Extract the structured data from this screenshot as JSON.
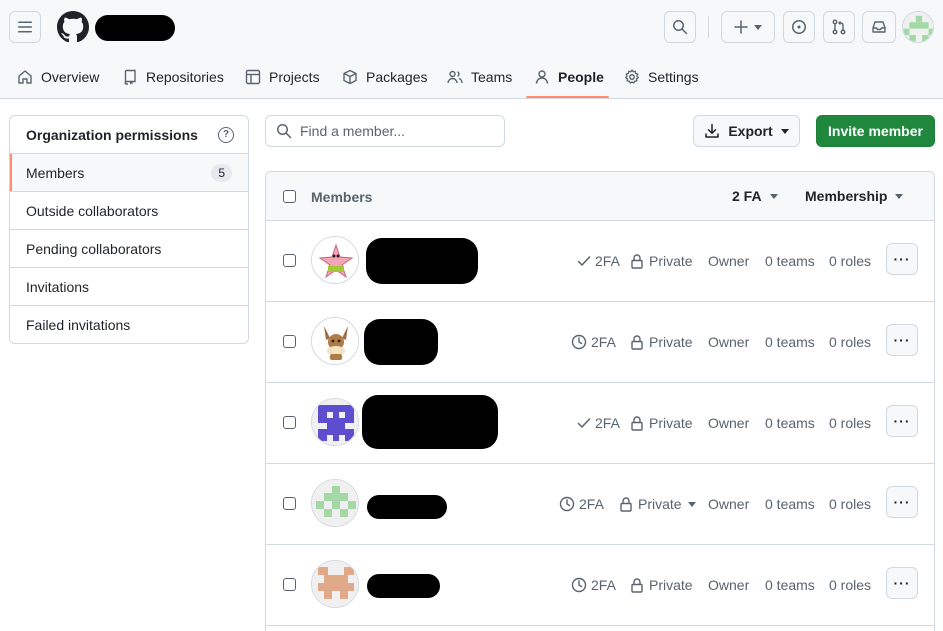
{
  "header": {
    "hamburger_icon": "three-bars-icon",
    "logo_icon": "github-mark-icon"
  },
  "nav": {
    "tabs": [
      {
        "label": "Overview",
        "icon": "home-icon"
      },
      {
        "label": "Repositories",
        "icon": "repo-icon"
      },
      {
        "label": "Projects",
        "icon": "table-icon"
      },
      {
        "label": "Packages",
        "icon": "package-icon"
      },
      {
        "label": "Teams",
        "icon": "people-icon"
      },
      {
        "label": "People",
        "icon": "person-icon",
        "active": true
      },
      {
        "label": "Settings",
        "icon": "gear-icon"
      }
    ]
  },
  "sidebar": {
    "title": "Organization permissions",
    "items": [
      {
        "label": "Members",
        "count": "5",
        "selected": true
      },
      {
        "label": "Outside collaborators"
      },
      {
        "label": "Pending collaborators"
      },
      {
        "label": "Invitations"
      },
      {
        "label": "Failed invitations"
      }
    ]
  },
  "toolbar": {
    "search_placeholder": "Find a member...",
    "export_label": "Export",
    "invite_label": "Invite member"
  },
  "table": {
    "header_members": "Members",
    "header_2fa": "2 FA",
    "header_membership": "Membership",
    "rows": [
      {
        "twofa": "2FA",
        "twofa_icon": "check-icon",
        "visibility": "Private",
        "role": "Owner",
        "teams": "0 teams",
        "roles": "0 roles",
        "avatar": "patrick-star-avatar"
      },
      {
        "twofa": "2FA",
        "twofa_icon": "clock-icon",
        "visibility": "Private",
        "role": "Owner",
        "teams": "0 teams",
        "roles": "0 roles",
        "avatar": "eevee-avatar"
      },
      {
        "twofa": "2FA",
        "twofa_icon": "check-icon",
        "visibility": "Private",
        "role": "Owner",
        "teams": "0 teams",
        "roles": "0 roles",
        "avatar": "purple-identicon-avatar"
      },
      {
        "twofa": "2FA",
        "twofa_icon": "clock-icon",
        "visibility": "Private",
        "role": "Owner",
        "teams": "0 teams",
        "roles": "0 roles",
        "avatar": "green-identicon-avatar",
        "visibility_dropdown": true
      },
      {
        "twofa": "2FA",
        "twofa_icon": "clock-icon",
        "visibility": "Private",
        "role": "Owner",
        "teams": "0 teams",
        "roles": "0 roles",
        "avatar": "orange-identicon-avatar"
      }
    ],
    "more_label": "···"
  },
  "colors": {
    "accent_underline": "#fd8c73",
    "invite_green": "#1f883d",
    "identicon_green": "#a3d9a5",
    "identicon_purple": "#5c4ecf",
    "identicon_orange": "#e0a98a"
  }
}
